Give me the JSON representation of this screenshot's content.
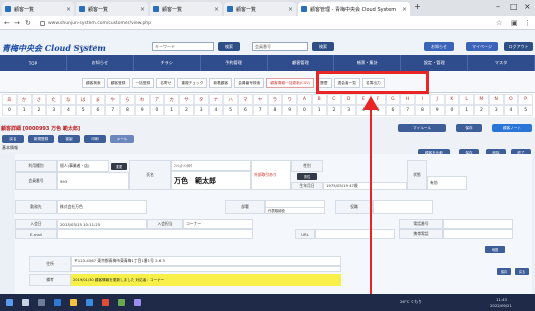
{
  "browser": {
    "tabs": [
      {
        "label": "顧客一覧"
      },
      {
        "label": "顧客一覧"
      },
      {
        "label": "顧客一覧"
      },
      {
        "label": "顧客一覧"
      },
      {
        "label": "顧客管理 - 青梅中央会 Cloud System"
      }
    ],
    "url": "www.shunjun-system.com/customer/view.php"
  },
  "header": {
    "logo": "青梅中央会 Cloud System",
    "logo_sub": "クラウドシステム",
    "search_placeholder": "キーワード",
    "search_button": "検索",
    "member_placeholder": "会員番号",
    "member_button": "検索",
    "right_buttons": [
      "お知らせ",
      "マイページ",
      "ログアウト"
    ]
  },
  "nav": {
    "items": [
      "TOP",
      "お知らせ",
      "チラシ",
      "予約管理",
      "顧客管理",
      "帳票・集計",
      "設定・管理",
      "マスタ"
    ]
  },
  "subnav": {
    "links": [
      "顧客検索",
      "顧客登録",
      "一括登録",
      "名寄せ",
      "重複チェック",
      "新着顧客",
      "会員番号検索",
      "顧客情報一括更新(CSV)",
      "履歴",
      "退会者一覧",
      "名簿出力"
    ],
    "highlighted_index": 7
  },
  "kana": {
    "row1": [
      "あ",
      "か",
      "さ",
      "た",
      "な",
      "は",
      "ま",
      "や",
      "ら",
      "わ",
      "ア",
      "カ",
      "サ",
      "タ",
      "ナ",
      "ハ",
      "マ",
      "ヤ",
      "ラ",
      "ワ",
      "A",
      "B",
      "C",
      "D",
      "E",
      "F",
      "G",
      "H",
      "I",
      "J",
      "K",
      "L",
      "M",
      "N",
      "O",
      "P"
    ],
    "row2": [
      "0",
      "1",
      "2",
      "3",
      "4",
      "5",
      "6",
      "7",
      "8",
      "9",
      "0",
      "1",
      "2",
      "3",
      "4",
      "5",
      "6",
      "7",
      "8",
      "9",
      "0",
      "1",
      "2",
      "3",
      "4",
      "5",
      "6",
      "7",
      "8",
      "9",
      "0",
      "1",
      "2",
      "3",
      "4",
      "5"
    ]
  },
  "toolbar": {
    "title": "顧客詳細 [0000993 万色 範太郎]",
    "left_buttons": [
      "戻る",
      "新規登録",
      "複製",
      "印刷",
      "メール"
    ],
    "right_buttons_top": [
      "マイルール",
      "保存",
      "顧客ノート"
    ],
    "right_buttons_row2": [
      "顧客を比較",
      "保存",
      "削除",
      "終了"
    ],
    "section_label": "基本情報"
  },
  "form": {
    "type_label": "利用種別",
    "type_value": "個人(事業者・店)",
    "type_btn": "変更",
    "name_label": "氏名",
    "name_kana": "ﾏﾝｼｮｸ ﾊﾝﾀﾛｳ",
    "name_value": "万色　範太郎",
    "warning": "外部取引あり",
    "gender_label": "性別",
    "gender_btn": "男性",
    "birthday_label": "生年月日",
    "birthday_value": "1975/05/19  47歳",
    "member_label": "会員番号",
    "member_value": "993",
    "status_label": "状態",
    "status_value": "有効",
    "company_label": "勤務先",
    "company_value": "株式会社万色",
    "dept_label": "部署",
    "dept_value": "",
    "title_label": "役職",
    "title_value": "",
    "position_value": "代表取締役",
    "reg_label": "入会日",
    "reg_value": "2013/03/15 10:11:25",
    "updater_label": "入会担当",
    "updater_value": "コーナー",
    "email_label": "E-mail",
    "email_value": "",
    "url_label": "URL",
    "url_value": "",
    "tel_label": "電話番号",
    "tel_value": "",
    "fax_label": "携帯電話",
    "fax_value": "",
    "address_label": "住所",
    "address_value": "〒123-4567 東京都青梅市東青梅1丁目1番1号  2-6  5",
    "address_line2": "",
    "memo_label": "備考",
    "memo_value": "2019/01/30  顧客情報を更新しました 対応者：コーナー",
    "bottom_btn": "地図",
    "save_btn": "保存",
    "cancel_btn": "戻る"
  },
  "taskbar": {
    "tray_text": "26°C くもり",
    "time": "11:43",
    "date": "2022/09/21"
  }
}
